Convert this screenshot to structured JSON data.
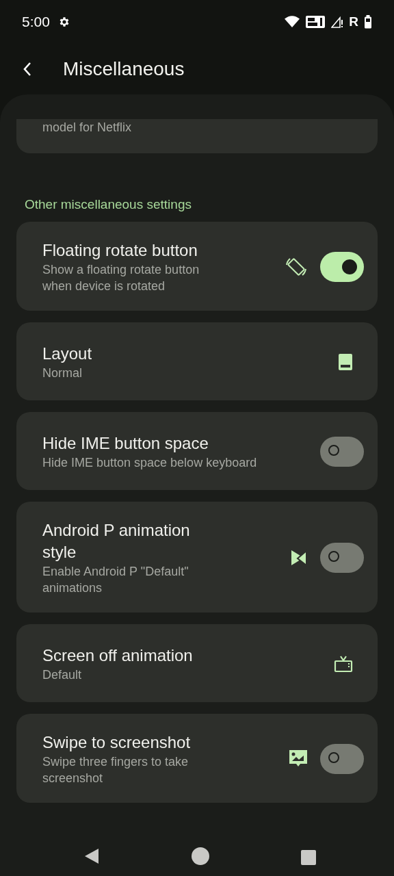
{
  "status_bar": {
    "time": "5:00",
    "network_label": "R"
  },
  "app_bar": {
    "title": "Miscellaneous"
  },
  "partial_card": {
    "summary": "model for Netflix"
  },
  "section": {
    "header": "Other miscellaneous settings"
  },
  "items": [
    {
      "kind": "toggle",
      "title": "Floating rotate button",
      "summary": "Show a floating rotate button when device is rotated",
      "on": true
    },
    {
      "kind": "value",
      "title": "Layout",
      "summary": "Normal"
    },
    {
      "kind": "toggle",
      "title": "Hide IME button space",
      "summary": "Hide IME button space below keyboard",
      "on": false
    },
    {
      "kind": "toggle",
      "title": "Android P animation style",
      "summary": "Enable Android P \"Default\" animations",
      "on": false
    },
    {
      "kind": "value",
      "title": "Screen off animation",
      "summary": "Default"
    },
    {
      "kind": "toggle",
      "title": "Swipe to screenshot",
      "summary": "Swipe three fingers to take screenshot",
      "on": false
    }
  ]
}
